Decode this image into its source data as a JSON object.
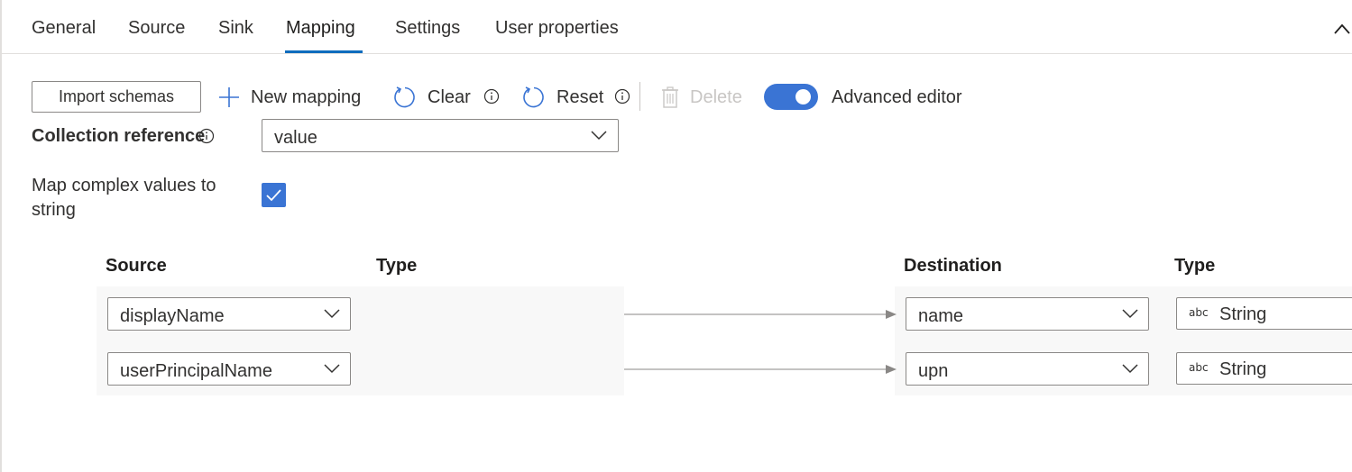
{
  "tabs": [
    {
      "label": "General"
    },
    {
      "label": "Source"
    },
    {
      "label": "Sink"
    },
    {
      "label": "Mapping",
      "active": true
    },
    {
      "label": "Settings"
    },
    {
      "label": "User properties"
    }
  ],
  "toolbar": {
    "import_label": "Import schemas",
    "new_mapping_label": "New mapping",
    "clear_label": "Clear",
    "reset_label": "Reset",
    "delete_label": "Delete",
    "advanced_editor_label": "Advanced editor",
    "advanced_editor_on": true
  },
  "fields": {
    "collection_reference_label": "Collection reference",
    "collection_reference_value": "value",
    "map_complex_label_line1": "Map complex values to",
    "map_complex_label_line2": "string",
    "map_complex_checked": true
  },
  "mapping": {
    "headers": {
      "source": "Source",
      "source_type": "Type",
      "destination": "Destination",
      "destination_type": "Type"
    },
    "rows": [
      {
        "source": "displayName",
        "destination": "name",
        "type_badge": "abc",
        "type": "String"
      },
      {
        "source": "userPrincipalName",
        "destination": "upn",
        "type_badge": "abc",
        "type": "String"
      }
    ]
  },
  "colors": {
    "accent": "#3a74d4",
    "tab_underline": "#0f6cbd",
    "border": "#8a8886"
  },
  "icons": [
    "chevron-up-icon",
    "plus-icon",
    "refresh-icon",
    "info-icon",
    "trash-icon",
    "chevron-down-icon",
    "checkmark-icon",
    "arrow-right-icon"
  ]
}
